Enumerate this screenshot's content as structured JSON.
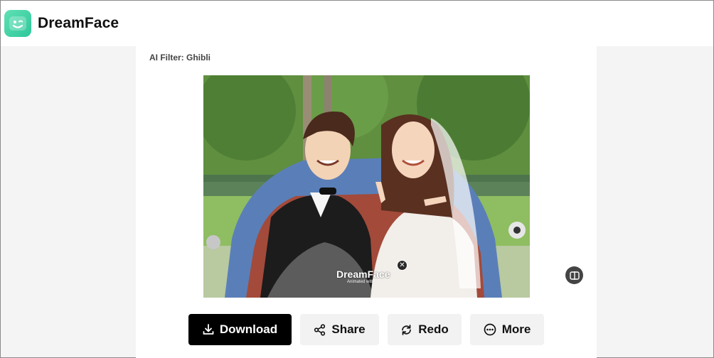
{
  "app": {
    "brand": "DreamFace",
    "accent_color": "#3dd3a4",
    "logo_icon": "smile-face-icon"
  },
  "result": {
    "filter_label": "AI Filter: Ghibli",
    "watermark": "DreamFace",
    "watermark_sub": "Animated with AI",
    "watermark_close": "✕"
  },
  "actions": {
    "download": {
      "label": "Download",
      "icon": "download-icon"
    },
    "share": {
      "label": "Share",
      "icon": "share-icon"
    },
    "redo": {
      "label": "Redo",
      "icon": "redo-icon"
    },
    "more": {
      "label": "More",
      "icon": "more-icon"
    }
  },
  "compare_icon": "compare-icon"
}
